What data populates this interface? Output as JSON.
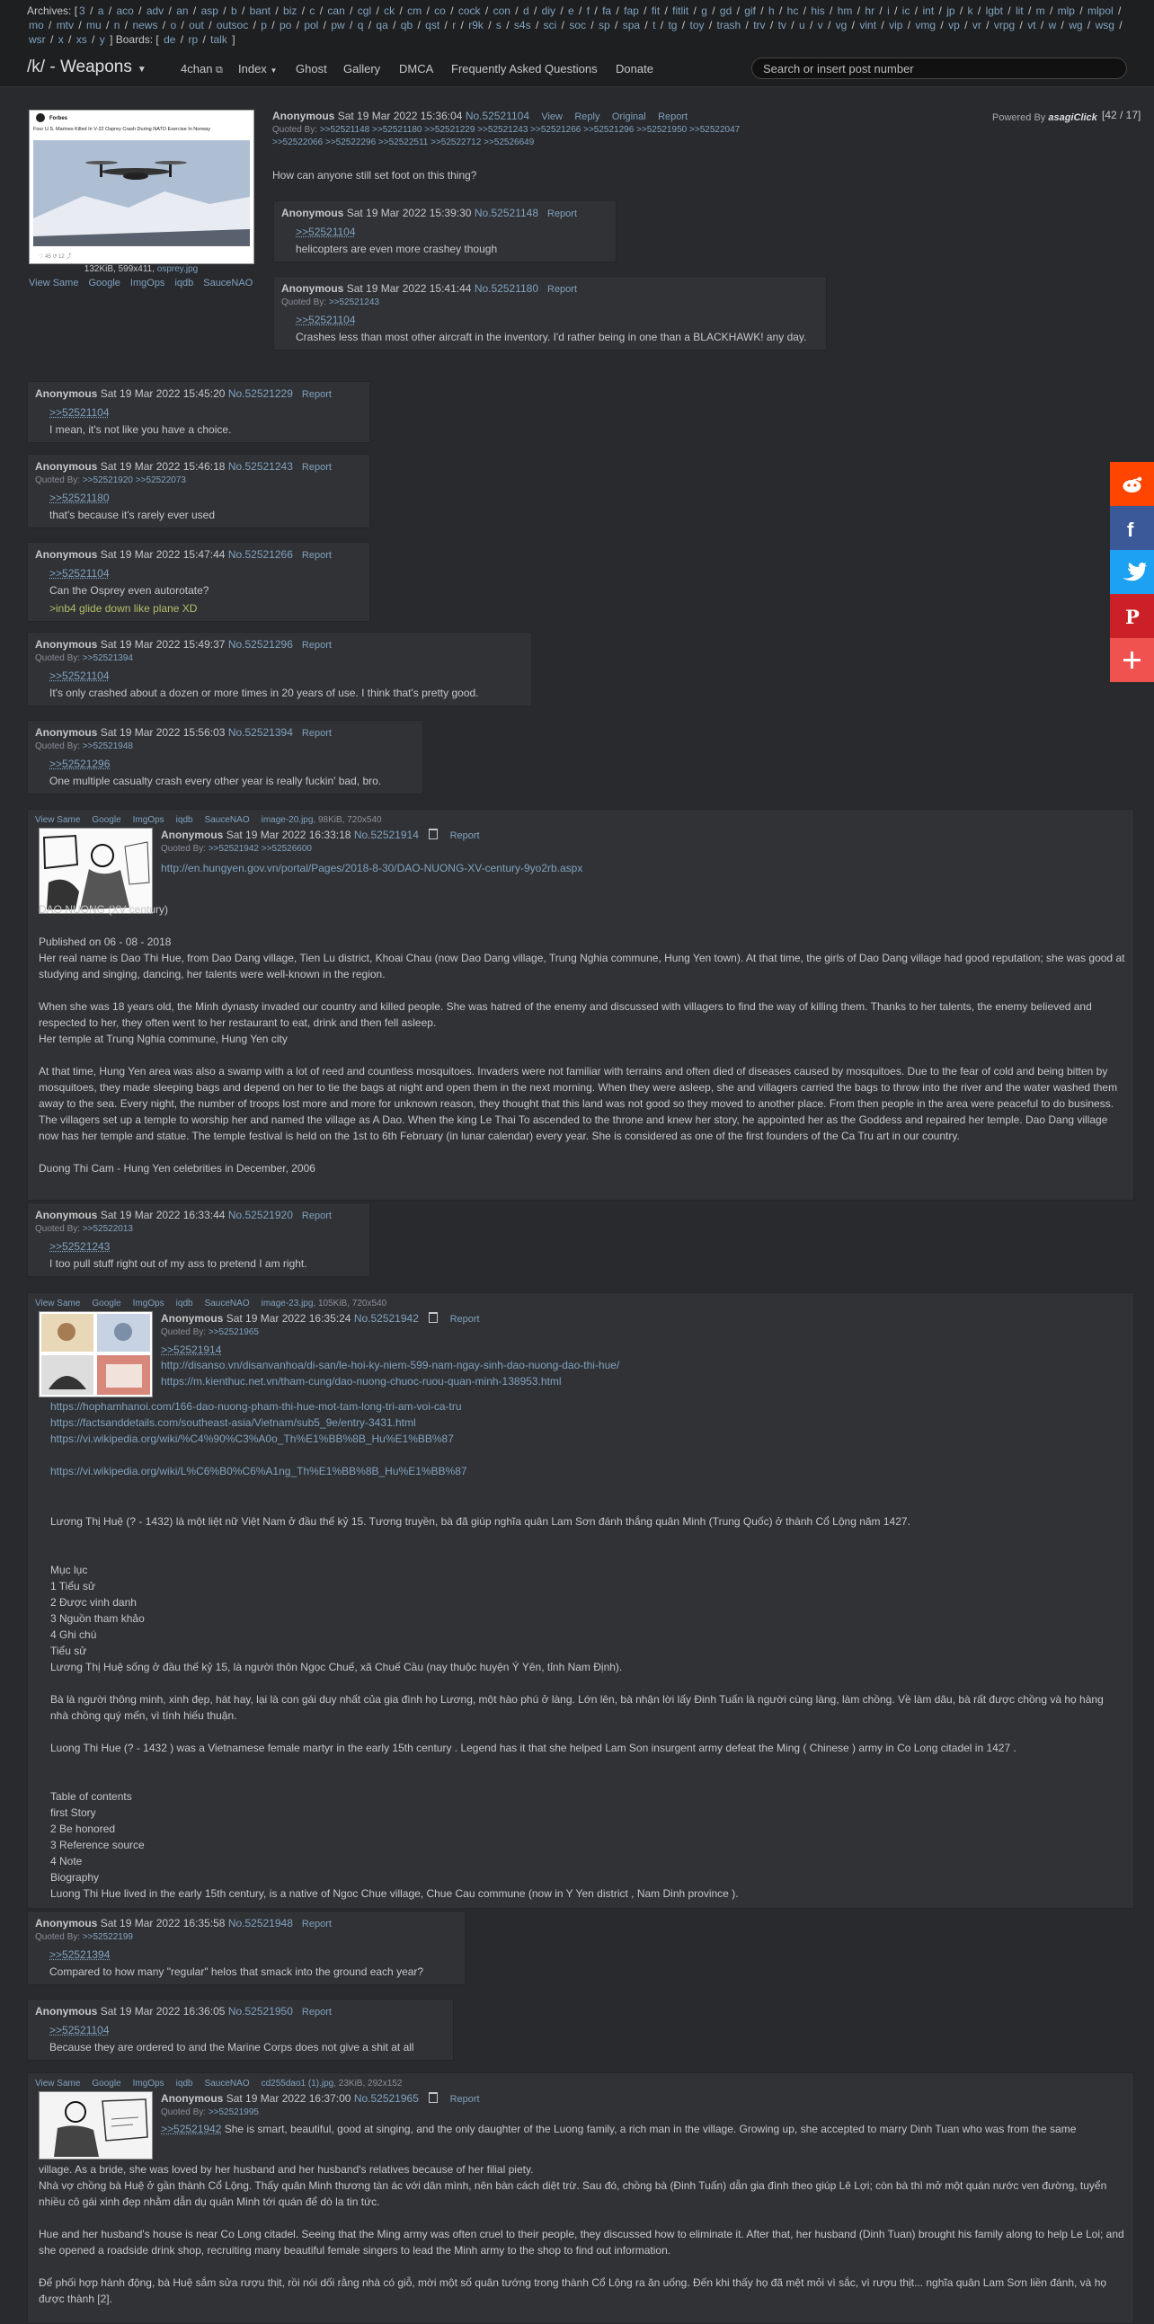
{
  "archives_label": "Archives:",
  "archives_bracket_open": "[",
  "archives": [
    "3",
    "a",
    "aco",
    "adv",
    "an",
    "asp",
    "b",
    "bant",
    "biz",
    "c",
    "can",
    "cgl",
    "ck",
    "cm",
    "co",
    "cock",
    "con",
    "d",
    "diy",
    "e",
    "f",
    "fa",
    "fap",
    "fit",
    "fitlit",
    "g",
    "gd",
    "gif",
    "h",
    "hc",
    "his",
    "hm",
    "hr",
    "i",
    "ic",
    "int",
    "jp",
    "k",
    "lgbt",
    "lit",
    "m",
    "mlp",
    "mlpol",
    "mo",
    "mtv",
    "mu",
    "n",
    "news",
    "o",
    "out",
    "outsoc",
    "p",
    "po",
    "pol",
    "pw",
    "q",
    "qa",
    "qb",
    "qst",
    "r",
    "r9k",
    "s",
    "s4s",
    "sci",
    "soc",
    "sp",
    "spa",
    "t",
    "tg",
    "toy",
    "trash",
    "trv",
    "tv",
    "u",
    "v",
    "vg",
    "vint",
    "vip",
    "vmg",
    "vp",
    "vr",
    "vrpg",
    "vt",
    "w",
    "wg",
    "wsg",
    "wsr",
    "x",
    "xs",
    "y"
  ],
  "boards_label": "] Boards: [",
  "boards": [
    "de",
    "rp",
    "talk"
  ],
  "boards_close": "]",
  "nav": {
    "title": "/k/ - Weapons",
    "items": [
      "4chan",
      "Index",
      "Ghost",
      "Gallery",
      "DMCA",
      "Frequently Asked Questions",
      "Donate"
    ],
    "search_placeholder": "Search or insert post number"
  },
  "powered_by": "Powered By",
  "powered_by_brand": "asagiClick",
  "reply_count": "[42 / 17]",
  "op": {
    "thumb_caption": "Four U.S. Marines Killed In V-22 Osprey Crash During NATO Exercise In Norway",
    "file_info": "132KiB, 599x411,",
    "file_name": "osprey.jpg",
    "search_links": [
      "View Same",
      "Google",
      "ImgOps",
      "iqdb",
      "SauceNAO"
    ],
    "name": "Anonymous",
    "date": "Sat 19 Mar 2022 15:36:04",
    "no": "No.52521104",
    "actions": [
      "View",
      "Reply",
      "Original",
      "Report"
    ],
    "quoted_label": "Quoted By:",
    "quoted": [
      ">>52521148",
      ">>52521180",
      ">>52521229",
      ">>52521243",
      ">>52521266",
      ">>52521296",
      ">>52521950",
      ">>52522047",
      ">>52522066",
      ">>52522296",
      ">>52522511",
      ">>52522712",
      ">>52526649"
    ],
    "text": "How can anyone still set foot on this thing?"
  },
  "report_label": "Report",
  "posts": [
    {
      "name": "Anonymous",
      "date": "Sat 19 Mar 2022 15:39:30",
      "no": "No.52521148",
      "quote": ">>52521104",
      "text": "helicopters are even more crashey though"
    },
    {
      "name": "Anonymous",
      "date": "Sat 19 Mar 2022 15:41:44",
      "no": "No.52521180",
      "quoted": [
        ">>52521243"
      ],
      "quote": ">>52521104",
      "text": "Crashes less than most other aircraft in the inventory. I'd rather being in one than a BLACKHAWK! any day."
    },
    {
      "name": "Anonymous",
      "date": "Sat 19 Mar 2022 15:45:20",
      "no": "No.52521229",
      "quote": ">>52521104",
      "text": "I mean, it's not like you have a choice."
    },
    {
      "name": "Anonymous",
      "date": "Sat 19 Mar 2022 15:46:18",
      "no": "No.52521243",
      "quoted": [
        ">>52521920",
        ">>52522073"
      ],
      "quote": ">>52521180",
      "text": "that's because it's rarely ever used"
    },
    {
      "name": "Anonymous",
      "date": "Sat 19 Mar 2022 15:47:44",
      "no": "No.52521266",
      "quote": ">>52521104",
      "text": "Can the Osprey even autorotate?",
      "green": ">inb4 glide down like plane XD"
    },
    {
      "name": "Anonymous",
      "date": "Sat 19 Mar 2022 15:49:37",
      "no": "No.52521296",
      "quoted": [
        ">>52521394"
      ],
      "quote": ">>52521104",
      "text": "It's only crashed about a dozen or more times in 20 years of use. I think that's pretty good."
    },
    {
      "name": "Anonymous",
      "date": "Sat 19 Mar 2022 15:56:03",
      "no": "No.52521394",
      "quoted": [
        ">>52521948"
      ],
      "quote": ">>52521296",
      "text": "One multiple casualty crash every other year is really fuckin' bad, bro."
    }
  ],
  "img_post_1": {
    "search_links": [
      "View Same",
      "Google",
      "ImgOps",
      "iqdb",
      "SauceNAO"
    ],
    "file_name": "image-20.jpg",
    "file_info": ", 98KiB, 720x540",
    "name": "Anonymous",
    "date": "Sat 19 Mar 2022 16:33:18",
    "no": "No.52521914",
    "quoted": [
      ">>52521942",
      ">>52526600"
    ],
    "link": "http://en.hungyen.gov.vn/portal/Pages/2018-8-30/DAO-NUONG-XV-century-9yo2rb.aspx",
    "text": "DAO NUONG (XV century)\n\nPublished on 06 - 08 - 2018\nHer real name is Dao Thi Hue, from Dao Dang village, Tien Lu district, Khoai Chau (now Dao Dang village, Trung Nghia commune, Hung Yen town). At that time, the girls of Dao Dang village had good reputation; she was good at studying and singing, dancing, her talents were well-known in the region.\n\nWhen she was 18 years old, the Minh dynasty invaded our country and killed people. She was hatred of the enemy and discussed with villagers to find the way of killing them. Thanks to her talents, the enemy believed and respected to her, they often went to her restaurant to eat, drink and then fell asleep.\nHer temple at Trung Nghia commune, Hung Yen city\n\nAt that time, Hung Yen area was also a swamp with a lot of reed and countless mosquitoes. Invaders were not familiar with terrains and often died of diseases caused by mosquitoes. Due to the fear of cold and being bitten by mosquitoes, they made sleeping bags and depend on her to tie the bags at night and open them in the next morning. When they were asleep, she and villagers carried the bags to throw into the river and the water washed them away to the sea. Every night, the number of troops lost more and more for unknown reason, they thought that this land was not good so they moved to another place. From then people in the area were peaceful to do business. The villagers set up a temple to worship her and named the village as A Dao. When the king Le Thai To ascended to the throne and knew her story, he appointed her as the Goddess and repaired her temple. Dao Dang village now has her temple and statue. The temple festival is held on the 1st to 6th February (in lunar calendar) every year. She is considered as one of the first founders of the Ca Tru art in our country.\n\nDuong Thi Cam - Hung Yen celebrities in December, 2006"
  },
  "post_920": {
    "name": "Anonymous",
    "date": "Sat 19 Mar 2022 16:33:44",
    "no": "No.52521920",
    "quoted": [
      ">>52522013"
    ],
    "quote": ">>52521243",
    "text": "I too pull stuff right out of my ass to pretend I am right."
  },
  "img_post_2": {
    "search_links": [
      "View Same",
      "Google",
      "ImgOps",
      "iqdb",
      "SauceNAO"
    ],
    "file_name": "image-23.jpg",
    "file_info": ", 105KiB, 720x540",
    "name": "Anonymous",
    "date": "Sat 19 Mar 2022 16:35:24",
    "no": "No.52521942",
    "quoted": [
      ">>52521965"
    ],
    "quote": ">>52521914",
    "links_top": [
      "http://disanso.vn/disanvanhoa/di-san/le-hoi-ky-niem-599-nam-ngay-sinh-dao-nuong-dao-thi-hue/",
      "https://m.kienthuc.net.vn/tham-cung/dao-nuong-chuoc-ruou-quan-minh-138953.html"
    ],
    "links": [
      "https://hophamhanoi.com/166-dao-nuong-pham-thi-hue-mot-tam-long-tri-am-voi-ca-tru",
      "https://factsanddetails.com/southeast-asia/Vietnam/sub5_9e/entry-3431.html",
      "https://vi.wikipedia.org/wiki/%C4%90%C3%A0o_Th%E1%BB%8B_Hu%E1%BB%87",
      "",
      "https://vi.wikipedia.org/wiki/L%C6%B0%C6%A1ng_Th%E1%BB%8B_Hu%E1%BB%87"
    ],
    "text": "\n\nLương Thị Huệ (? - 1432) là một liệt nữ Việt Nam ở đầu thế kỷ 15. Tương truyền, bà đã giúp nghĩa quân Lam Sơn đánh thắng quân Minh (Trung Quốc) ở thành Cổ Lộng năm 1427.\n\n\nMục lục\n1 Tiểu sử\n2 Được vinh danh\n3 Nguồn tham khảo\n4 Ghi chú\nTiểu sử\nLương Thị Huệ sống ở đầu thế kỷ 15, là người thôn Ngọc Chuế, xã Chuế Cầu (nay thuộc huyện Ý Yên, tỉnh Nam Định).\n\nBà là người thông minh, xinh đẹp, hát hay, lại là con gái duy nhất của gia đình họ Lương, một hào phú ở làng. Lớn lên, bà nhận lời lấy Đinh Tuấn là người cùng làng, làm chồng. Về làm dâu, bà rất được chồng và họ hàng nhà chồng quý mến, vì tính hiếu thuận.\n\nLuong Thi Hue (? - 1432 ) was a Vietnamese female martyr in the early 15th century . Legend has it that she helped Lam Son insurgent army defeat the Ming ( Chinese ) army in Co Long citadel in 1427 .\n\n\nTable of contents\nfirst Story\n2 Be honored\n3 Reference source\n4 Note\nBiography\nLuong Thi Hue lived in the early 15th century, is a native of Ngoc Chue village, Chue Cau commune (now in Y Yen district , Nam Dinh province )."
  },
  "post_948": {
    "name": "Anonymous",
    "date": "Sat 19 Mar 2022 16:35:58",
    "no": "No.52521948",
    "quoted": [
      ">>52522199"
    ],
    "quote": ">>52521394",
    "text": "Compared to how many \"regular\" helos that smack into the ground each year?"
  },
  "post_950": {
    "name": "Anonymous",
    "date": "Sat 19 Mar 2022 16:36:05",
    "no": "No.52521950",
    "quote": ">>52521104",
    "text": "Because they are ordered to and the Marine Corps does not give a shit at all"
  },
  "img_post_3": {
    "search_links": [
      "View Same",
      "Google",
      "ImgOps",
      "iqdb",
      "SauceNAO"
    ],
    "file_name": "cd255dao1 (1).jpg",
    "file_info": ", 23KiB, 292x152",
    "name": "Anonymous",
    "date": "Sat 19 Mar 2022 16:37:00",
    "no": "No.52521965",
    "quoted": [
      ">>52521995"
    ],
    "quote": ">>52521942",
    "text_inline": "She is smart, beautiful, good at singing, and the only daughter of the Luong family, a rich man in the village. Growing up, she accepted to marry Dinh Tuan who was from the same",
    "text": "village. As a bride, she was loved by her husband and her husband's relatives because of her filial piety.\nNhà vợ chồng bà Huệ ở gần thành Cổ Lộng. Thấy quân Minh thương tàn ác với dân mình, nên bàn cách diệt trừ. Sau đó, chồng bà (Đinh Tuấn) dẫn gia đình theo giúp Lê Lợi; còn bà thì mở một quán nước ven đường, tuyển nhiều cô gái xinh đẹp nhằm dẫn dụ quân Minh tới quán để dò la tin tức.\n\nHue and her husband's house is near Co Long citadel. Seeing that the Ming army was often cruel to their people, they discussed how to eliminate it. After that, her husband (Dinh Tuan) brought his family along to help Le Loi; and she opened a roadside drink shop, recruiting many beautiful female singers to lead the Minh army to the shop to find out information.\n\nĐể phối hợp hành động, bà Huệ sắm sửa rượu thịt, rồi nói dối rằng nhà có giỗ, mời một số quân tướng trong thành Cổ Lộng ra ăn uống. Đến khi thấy họ đã mệt mỏi vì sắc, vì rượu thịt... nghĩa quân Lam Sơn liền đánh, và họ được thành [2]."
  },
  "social": [
    "reddit-icon",
    "facebook-icon",
    "twitter-icon",
    "pinterest-icon",
    "plus-icon"
  ],
  "colors": {
    "background": "#282a2e",
    "post": "#303236",
    "link": "#81a2be",
    "greentext": "#b5bd68",
    "reddit": "#ff4500",
    "facebook": "#3b5998",
    "twitter": "#1da1f2",
    "pinterest": "#cb2027",
    "plus": "#f0524f"
  }
}
